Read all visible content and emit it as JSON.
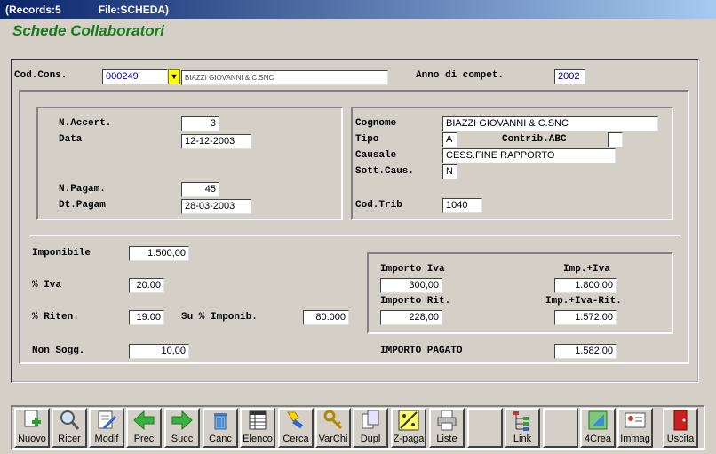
{
  "window": {
    "records": "(Records:5",
    "file": "File:SCHEDA)"
  },
  "form_title": "Schede Collaboratori",
  "header": {
    "cod_cons_label": "Cod.Cons.",
    "cod_cons_value": "000249",
    "cod_cons_name": "BIAZZI GIOVANNI & C.SNC",
    "anno_label": "Anno di compet.",
    "anno_value": "2002"
  },
  "left_panel": {
    "n_accert_label": "N.Accert.",
    "n_accert_value": "3",
    "data_label": "Data",
    "data_value": "12-12-2003",
    "n_pagam_label": "N.Pagam.",
    "n_pagam_value": "45",
    "dt_pagam_label": "Dt.Pagam",
    "dt_pagam_value": "28-03-2003"
  },
  "right_panel": {
    "cognome_label": "Cognome",
    "cognome_value": "BIAZZI GIOVANNI & C.SNC",
    "tipo_label": "Tipo",
    "tipo_value": "A",
    "contrib_label": "Contrib.ABC",
    "contrib_value": "",
    "causale_label": "Causale",
    "causale_value": "CESS.FINE RAPPORTO",
    "sott_caus_label": "Sott.Caus.",
    "sott_caus_value": "N",
    "cod_trib_label": "Cod.Trib",
    "cod_trib_value": "1040"
  },
  "amounts": {
    "imponibile_label": "Imponibile",
    "imponibile_value": "1.500,00",
    "iva_label": "% Iva",
    "iva_value": "20.00",
    "riten_label": "% Riten.",
    "riten_value": "19.00",
    "su_imponib_label": "Su % Imponib.",
    "su_imponib_value": "80.000",
    "non_sogg_label": "Non Sogg.",
    "non_sogg_value": "10,00",
    "importo_iva_label": "Importo Iva",
    "importo_iva_value": "300,00",
    "imp_iva_label": "Imp.+Iva",
    "imp_iva_value": "1.800,00",
    "importo_rit_label": "Importo Rit.",
    "importo_rit_value": "228,00",
    "imp_iva_rit_label": "Imp.+Iva-Rit.",
    "imp_iva_rit_value": "1.572,00",
    "importo_pagato_label": "IMPORTO PAGATO",
    "importo_pagato_value": "1.582,00"
  },
  "toolbar": [
    {
      "label": "Nuovo",
      "icon": "new-doc-icon"
    },
    {
      "label": "Ricer",
      "icon": "magnifier-icon"
    },
    {
      "label": "Modif",
      "icon": "edit-icon"
    },
    {
      "label": "Prec",
      "icon": "arrow-left-icon"
    },
    {
      "label": "Succ",
      "icon": "arrow-right-icon"
    },
    {
      "label": "Canc",
      "icon": "trash-icon"
    },
    {
      "label": "Elenco",
      "icon": "list-icon"
    },
    {
      "label": "Cerca",
      "icon": "flashlight-icon"
    },
    {
      "label": "VarChi",
      "icon": "keys-icon"
    },
    {
      "label": "Dupl",
      "icon": "copy-icon"
    },
    {
      "label": "Z-paga",
      "icon": "pay-icon"
    },
    {
      "label": "Liste",
      "icon": "printer-icon"
    },
    {
      "label": "",
      "icon": ""
    },
    {
      "label": "Link",
      "icon": "link-tree-icon"
    },
    {
      "label": "",
      "icon": ""
    },
    {
      "label": "4Crea",
      "icon": "create-icon"
    },
    {
      "label": "Immag",
      "icon": "image-card-icon"
    },
    {
      "label": "",
      "icon": ""
    },
    {
      "label": "Uscita",
      "icon": "exit-door-icon"
    }
  ]
}
